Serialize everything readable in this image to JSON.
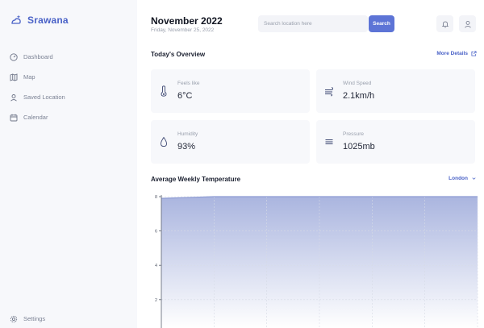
{
  "brand": {
    "name": "Srawana"
  },
  "sidebar": {
    "items": [
      {
        "label": "Dashboard",
        "icon": "gauge-icon"
      },
      {
        "label": "Map",
        "icon": "map-icon"
      },
      {
        "label": "Saved Location",
        "icon": "location-pin-icon"
      },
      {
        "label": "Calendar",
        "icon": "calendar-icon"
      }
    ],
    "settings_label": "Settings"
  },
  "header": {
    "month": "November 2022",
    "date": "Friday, November 25, 2022",
    "search_placeholder": "Search location here",
    "search_button": "Search"
  },
  "overview": {
    "title": "Today's Overview",
    "more_link": "More Details",
    "cards": [
      {
        "label": "Feels like",
        "value": "6°C",
        "icon": "thermometer-icon"
      },
      {
        "label": "Wind Speed",
        "value": "2.1km/h",
        "icon": "wind-icon"
      },
      {
        "label": "Humidity",
        "value": "93%",
        "icon": "droplet-icon"
      },
      {
        "label": "Pressure",
        "value": "1025mb",
        "icon": "pressure-lines-icon"
      }
    ]
  },
  "weekly": {
    "title": "Average Weekly Temperature",
    "location_select": "London"
  },
  "colors": {
    "accent": "#5d74d6",
    "brand": "#4a62c7",
    "sidebar_bg": "#f7f8fb"
  },
  "chart_data": {
    "type": "area",
    "x": [
      0,
      1,
      2,
      3,
      4,
      5,
      6
    ],
    "y": [
      7.9,
      8,
      8,
      8,
      8,
      8,
      8
    ],
    "yticks": [
      "8",
      "6",
      "4",
      "2"
    ],
    "ylim": [
      0,
      8
    ],
    "grid": true
  }
}
